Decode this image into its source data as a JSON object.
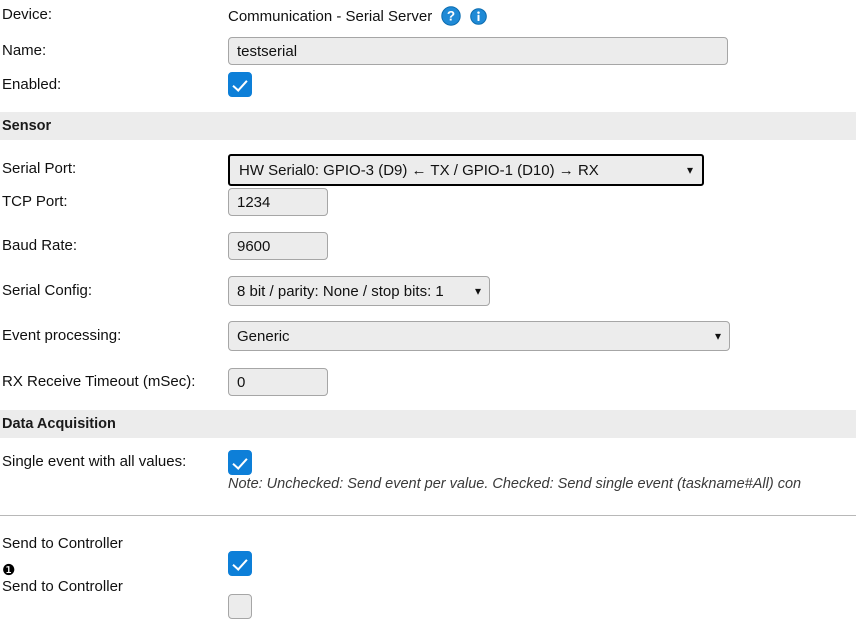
{
  "form": {
    "device": {
      "label": "Device:",
      "value": "Communication - Serial Server",
      "help_icon": "question-mark-circle-icon",
      "info_icon": "info-circle-icon"
    },
    "name": {
      "label": "Name:",
      "value": "testserial",
      "placeholder": ""
    },
    "enabled": {
      "label": "Enabled:",
      "checked": true
    }
  },
  "sensor": {
    "header": "Sensor",
    "serial_port": {
      "label": "Serial Port:",
      "value": "HW Serial0: GPIO-3 (D9) ← TX / GPIO-1 (D10) → RX",
      "focused": true
    },
    "tcp_port": {
      "label": "TCP Port:",
      "value": "1234"
    },
    "baud_rate": {
      "label": "Baud Rate:",
      "value": "9600"
    },
    "serial_config": {
      "label": "Serial Config:",
      "value": "8 bit / parity: None / stop bits: 1"
    },
    "event_processing": {
      "label": "Event processing:",
      "value": "Generic"
    },
    "rx_timeout": {
      "label": "RX Receive Timeout (mSec):",
      "value": "0"
    }
  },
  "data_acquisition": {
    "header": "Data Acquisition",
    "single_event": {
      "label": "Single event with all values:",
      "checked": true,
      "note": "Note: Unchecked: Send event per value. Checked: Send single event (taskname#All) con"
    },
    "send_to_controller_1": {
      "label": "Send to Controller",
      "index": "❶",
      "checked": true
    },
    "send_to_controller_2": {
      "label": "Send to Controller",
      "checked": false
    }
  },
  "colors": {
    "checkbox_blue": "#0d7fd8",
    "icon_blue": "#1f8ad6",
    "section_bar": "#ececec",
    "field_bg": "#ececec",
    "field_border": "#a6a6a6"
  }
}
